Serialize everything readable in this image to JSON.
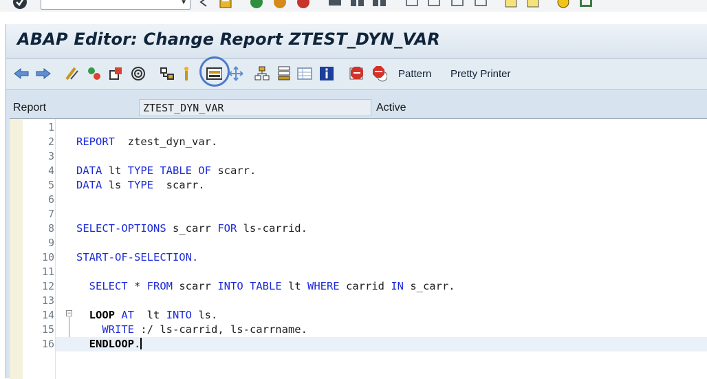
{
  "system_toolbar": {
    "icons": [
      "enter-icon",
      "back-icon",
      "save-icon",
      "back-green-icon",
      "exit-icon",
      "cancel-icon",
      "print-icon",
      "find-icon",
      "find-next-icon",
      "first-page-icon",
      "prev-page-icon",
      "next-page-icon",
      "last-page-icon",
      "new-session-icon",
      "shortcut-icon",
      "help-icon",
      "layout-icon"
    ]
  },
  "window": {
    "title": "ABAP Editor: Change Report ZTEST_DYN_VAR"
  },
  "app_toolbar": {
    "pattern_label": "Pattern",
    "pretty_printer_label": "Pretty Printer"
  },
  "header": {
    "report_label": "Report",
    "report_value": "ZTEST_DYN_VAR",
    "status": "Active"
  },
  "editor": {
    "lines": [
      {
        "n": "1",
        "tokens": []
      },
      {
        "n": "2",
        "tokens": [
          {
            "t": "REPORT",
            "c": "kw"
          },
          {
            "t": "  ztest_dyn_var.",
            "c": "plain"
          }
        ]
      },
      {
        "n": "3",
        "tokens": []
      },
      {
        "n": "4",
        "tokens": [
          {
            "t": "DATA",
            "c": "kw"
          },
          {
            "t": " lt ",
            "c": "plain"
          },
          {
            "t": "TYPE TABLE OF",
            "c": "kw"
          },
          {
            "t": " scarr.",
            "c": "plain"
          }
        ]
      },
      {
        "n": "5",
        "tokens": [
          {
            "t": "DATA",
            "c": "kw"
          },
          {
            "t": " ls ",
            "c": "plain"
          },
          {
            "t": "TYPE",
            "c": "kw"
          },
          {
            "t": "  scarr.",
            "c": "plain"
          }
        ]
      },
      {
        "n": "6",
        "tokens": []
      },
      {
        "n": "7",
        "tokens": []
      },
      {
        "n": "8",
        "tokens": [
          {
            "t": "SELECT-OPTIONS",
            "c": "kw"
          },
          {
            "t": " s_carr ",
            "c": "plain"
          },
          {
            "t": "FOR",
            "c": "kw"
          },
          {
            "t": " ls-carrid.",
            "c": "plain"
          }
        ]
      },
      {
        "n": "9",
        "tokens": []
      },
      {
        "n": "10",
        "tokens": [
          {
            "t": "START-OF-SELECTION.",
            "c": "kw"
          }
        ]
      },
      {
        "n": "11",
        "tokens": []
      },
      {
        "n": "12",
        "tokens": [
          {
            "t": "  ",
            "c": "plain"
          },
          {
            "t": "SELECT",
            "c": "kw"
          },
          {
            "t": " * ",
            "c": "plain"
          },
          {
            "t": "FROM",
            "c": "kw"
          },
          {
            "t": " scarr ",
            "c": "plain"
          },
          {
            "t": "INTO TABLE",
            "c": "kw"
          },
          {
            "t": " lt ",
            "c": "plain"
          },
          {
            "t": "WHERE",
            "c": "kw"
          },
          {
            "t": " carrid ",
            "c": "plain"
          },
          {
            "t": "IN",
            "c": "kw"
          },
          {
            "t": " s_carr.",
            "c": "plain"
          }
        ]
      },
      {
        "n": "13",
        "tokens": []
      },
      {
        "n": "14",
        "tokens": [
          {
            "t": "  ",
            "c": "plain"
          },
          {
            "t": "LOOP",
            "c": "bold"
          },
          {
            "t": " ",
            "c": "plain"
          },
          {
            "t": "AT",
            "c": "kw"
          },
          {
            "t": "  lt ",
            "c": "plain"
          },
          {
            "t": "INTO",
            "c": "kw"
          },
          {
            "t": " ls.",
            "c": "plain"
          }
        ]
      },
      {
        "n": "15",
        "tokens": [
          {
            "t": "    ",
            "c": "plain"
          },
          {
            "t": "WRITE",
            "c": "kw"
          },
          {
            "t": " :/ ls-carrid, ls-carrname.",
            "c": "plain"
          }
        ]
      },
      {
        "n": "16",
        "tokens": [
          {
            "t": "  ",
            "c": "plain"
          },
          {
            "t": "ENDLOOP",
            "c": "bold"
          },
          {
            "t": ".",
            "c": "plain"
          }
        ],
        "current": true
      }
    ]
  }
}
